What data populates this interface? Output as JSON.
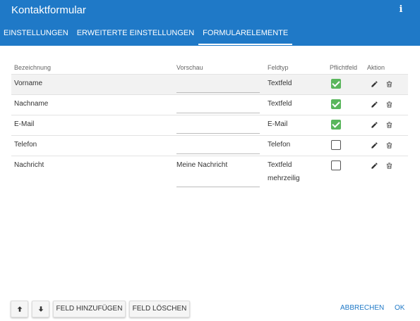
{
  "header": {
    "title": "Kontaktformular",
    "icons": [
      "info-icon"
    ],
    "accent_color": "#1f79c7"
  },
  "tabs": [
    {
      "label": "EINSTELLUNGEN",
      "active": false
    },
    {
      "label": "ERWEITERTE EINSTELLUNGEN",
      "active": false
    },
    {
      "label": "FORMULARELEMENTE",
      "active": true
    }
  ],
  "table": {
    "columns": [
      "Bezeichnung",
      "Vorschau",
      "Feldtyp",
      "Pflichtfeld",
      "Aktion"
    ],
    "rows": [
      {
        "label": "Vorname",
        "preview": "",
        "type": "Textfeld",
        "type_line2": "",
        "required": true
      },
      {
        "label": "Nachname",
        "preview": "",
        "type": "Textfeld",
        "type_line2": "",
        "required": true
      },
      {
        "label": "E-Mail",
        "preview": "",
        "type": "E-Mail",
        "type_line2": "",
        "required": true
      },
      {
        "label": "Telefon",
        "preview": "",
        "type": "Telefon",
        "type_line2": "",
        "required": false
      },
      {
        "label": "Nachricht",
        "preview": "Meine Nachricht",
        "type": "Textfeld",
        "type_line2": "mehrzeilig",
        "required": false
      }
    ],
    "action_icons": [
      "pencil-icon",
      "trash-icon"
    ],
    "check_color": "#5ab65c"
  },
  "footer": {
    "up_icon": "arrow-up-icon",
    "down_icon": "arrow-down-icon",
    "add_label": "FELD HINZUFÜGEN",
    "delete_label": "FELD LÖSCHEN",
    "cancel_label": "ABBRECHEN",
    "ok_label": "OK"
  }
}
